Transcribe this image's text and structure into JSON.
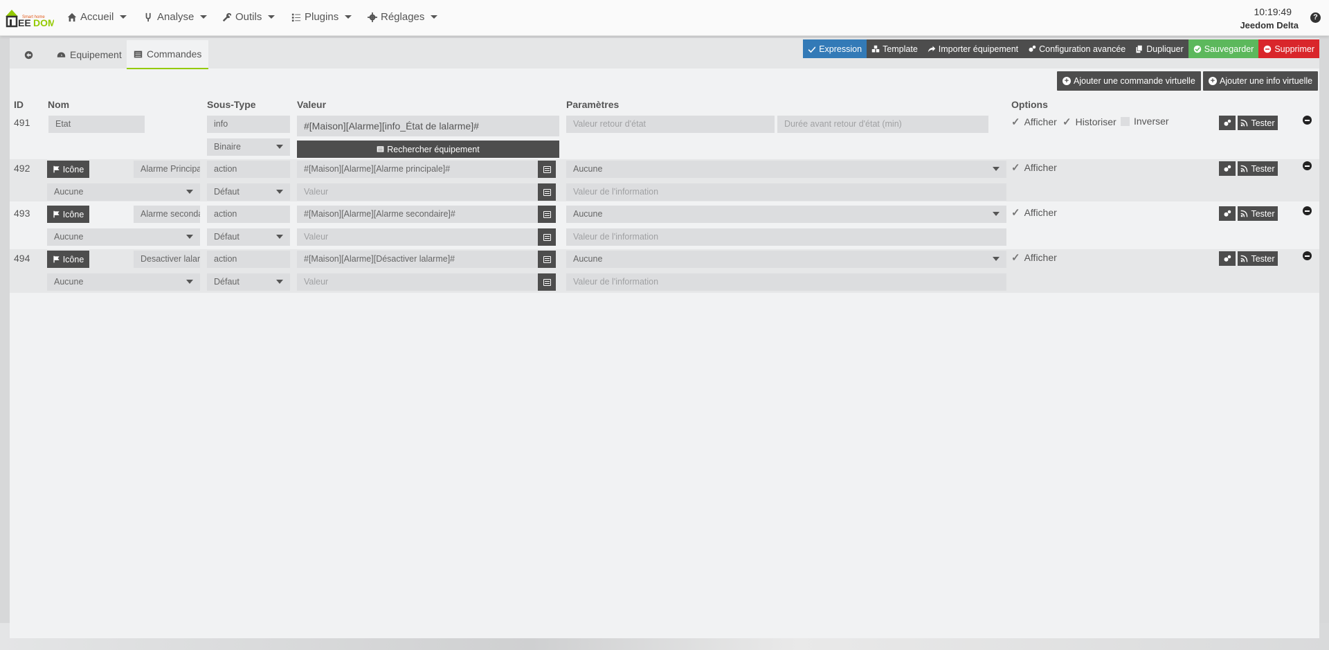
{
  "navbar": {
    "logo_text": "JEEDOM",
    "logo_sub": "Smart home",
    "menus": [
      {
        "label": "Accueil",
        "icon": "home-icon"
      },
      {
        "label": "Analyse",
        "icon": "stethoscope-icon"
      },
      {
        "label": "Outils",
        "icon": "wrench-icon"
      },
      {
        "label": "Plugins",
        "icon": "tasks-icon"
      },
      {
        "label": "Réglages",
        "icon": "gear-icon"
      }
    ],
    "clock": "10:19:49",
    "system_name": "Jeedom Delta",
    "help_label": "?"
  },
  "tabs": {
    "back_icon": "arrow-left-circle-icon",
    "equipement": "Equipement",
    "commandes": "Commandes"
  },
  "actions": {
    "expression": "Expression",
    "template": "Template",
    "importer": "Importer équipement",
    "config": "Configuration avancée",
    "dupliquer": "Dupliquer",
    "sauvegarder": "Sauvegarder",
    "supprimer": "Supprimer"
  },
  "add_buttons": {
    "commande_virtuelle": "Ajouter une commande virtuelle",
    "info_virtuelle": "Ajouter une info virtuelle"
  },
  "columns": {
    "id": "ID",
    "nom": "Nom",
    "sous_type": "Sous-Type",
    "valeur": "Valeur",
    "parametres": "Paramètres",
    "options": "Options"
  },
  "common": {
    "icone": "Icône",
    "tester": "Tester",
    "afficher": "Afficher",
    "historiser": "Historiser",
    "inverser": "Inverser",
    "rechercher": "Rechercher équipement",
    "valeur_placeholder": "Valeur",
    "valeur_info_placeholder": "Valeur de l'information",
    "retour_etat_placeholder": "Valeur retour d'état",
    "duree_placeholder": "Durée avant retour d'état (min)"
  },
  "info_cmd": {
    "id": "491",
    "name": "Etat",
    "type": "info",
    "subtype": "Binaire",
    "value": "#[Maison][Alarme][info_État de lalarme]#"
  },
  "action_cmds": [
    {
      "id": "492",
      "name": "Alarme Principale",
      "type": "action",
      "subtype": "Défaut",
      "value": "#[Maison][Alarme][Alarme principale]#",
      "generic": "Aucune",
      "param": "Aucune"
    },
    {
      "id": "493",
      "name": "Alarme secondaire",
      "type": "action",
      "subtype": "Défaut",
      "value": "#[Maison][Alarme][Alarme secondaire]#",
      "generic": "Aucune",
      "param": "Aucune"
    },
    {
      "id": "494",
      "name": "Desactiver lalarme",
      "type": "action",
      "subtype": "Défaut",
      "value": "#[Maison][Alarme][Désactiver lalarme]#",
      "generic": "Aucune",
      "param": "Aucune"
    }
  ]
}
